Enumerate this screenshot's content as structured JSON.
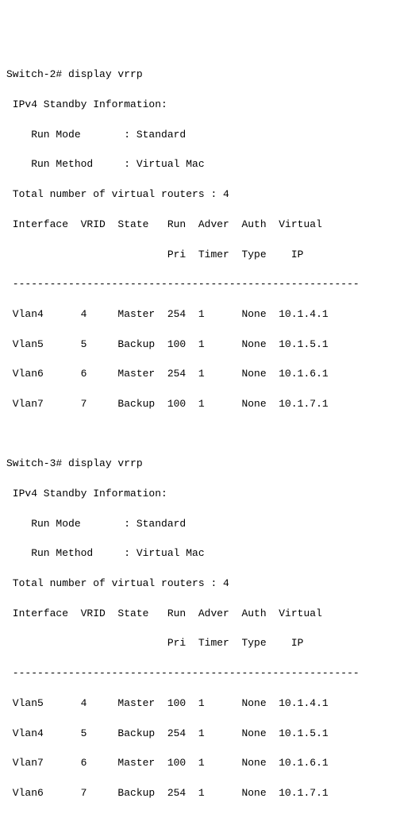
{
  "blocks": [
    {
      "prompt": "Switch-2# display vrrp",
      "header1": " IPv4 Standby Information:",
      "run_mode_line": "    Run Mode       : Standard",
      "run_method_line": "    Run Method     : Virtual Mac",
      "total_line": " Total number of virtual routers : 4",
      "col_line1": " Interface  VRID  State   Run  Adver  Auth  Virtual",
      "col_line2": "                          Pri  Timer  Type    IP",
      "divider": " --------------------------------------------------------",
      "rows": [
        " Vlan4      4     Master  254  1      None  10.1.4.1",
        " Vlan5      5     Backup  100  1      None  10.1.5.1",
        " Vlan6      6     Master  254  1      None  10.1.6.1",
        " Vlan7      7     Backup  100  1      None  10.1.7.1"
      ]
    },
    {
      "prompt": "Switch-3# display vrrp",
      "header1": " IPv4 Standby Information:",
      "run_mode_line": "    Run Mode       : Standard",
      "run_method_line": "    Run Method     : Virtual Mac",
      "total_line": " Total number of virtual routers : 4",
      "col_line1": " Interface  VRID  State   Run  Adver  Auth  Virtual",
      "col_line2": "                          Pri  Timer  Type    IP",
      "divider": " --------------------------------------------------------",
      "rows": [
        " Vlan5      4     Master  100  1      None  10.1.4.1",
        " Vlan4      5     Backup  254  1      None  10.1.5.1",
        " Vlan7      6     Master  100  1      None  10.1.6.1",
        " Vlan6      7     Backup  254  1      None  10.1.7.1"
      ]
    }
  ]
}
